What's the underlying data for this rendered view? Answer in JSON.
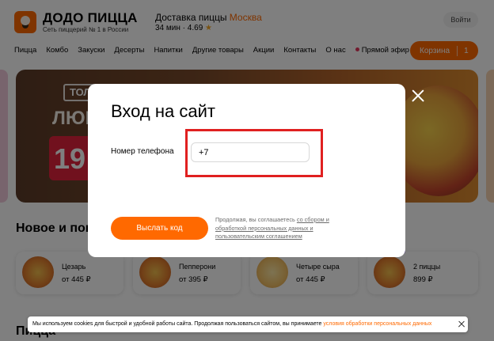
{
  "header": {
    "brand": "ДОДО ПИЦЦА",
    "tagline": "Сеть пиццерий № 1 в России",
    "delivery_label": "Доставка пиццы",
    "city": "Москва",
    "delivery_time": "34 мин",
    "rating": "4.69",
    "login_label": "Войти",
    "cart_label": "Корзина",
    "cart_count": "1",
    "accent_color": "#ff6900"
  },
  "nav": {
    "items": [
      "Пицца",
      "Комбо",
      "Закуски",
      "Десерты",
      "Напитки",
      "Другие товары",
      "Акции",
      "Контакты",
      "О нас"
    ],
    "live_label": "Прямой эфир"
  },
  "promo": {
    "tag": "ТОЛЬКО",
    "headline": "ЛЮБ",
    "number": "19"
  },
  "products_section": {
    "title": "Новое и популярное",
    "items": [
      {
        "name": "Цезарь",
        "price": "от 445 ₽"
      },
      {
        "name": "Пепперони",
        "price": "от 395 ₽"
      },
      {
        "name": "Четыре сыра",
        "price": "от 445 ₽"
      },
      {
        "name": "2 пиццы",
        "price": "899 ₽"
      }
    ]
  },
  "next_section": {
    "title": "Пицца"
  },
  "modal": {
    "title": "Вход на сайт",
    "phone_label": "Номер телефона",
    "phone_value": "+7",
    "send_button": "Выслать код",
    "agreement_prefix": "Продолжая, вы соглашаетесь",
    "agreement_link_1": "со сбором и обработкой персональных данных и пользовательским соглашением",
    "highlight_color": "#e02020"
  },
  "cookie": {
    "text": "Мы используем cookies для быстрой и удобной работы сайта. Продолжая пользоваться сайтом, вы принимаете",
    "link": "условия обработки персональных данных"
  }
}
